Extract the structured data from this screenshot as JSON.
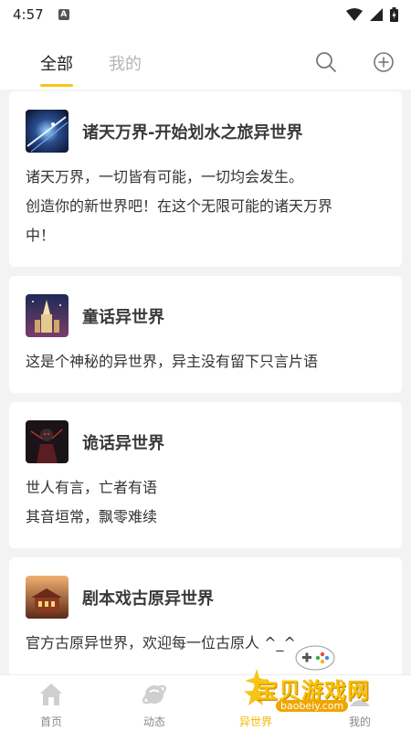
{
  "status_bar": {
    "time": "4:57",
    "notification_letter": "A"
  },
  "header": {
    "tabs": [
      {
        "label": "全部",
        "active": true
      },
      {
        "label": "我的",
        "active": false
      }
    ],
    "accent_color": "#f5c518"
  },
  "worlds": [
    {
      "title": "诸天万界-开始划水之旅异世界",
      "lines": [
        "诸天万界，一切皆有可能，一切均会发生。",
        "创造你的新世界吧！在这个无限可能的诸天万界",
        "中！"
      ],
      "avatar_icon": "galaxy-image"
    },
    {
      "title": "童话异世界",
      "lines": [
        "这是个神秘的异世界，异主没有留下只言片语"
      ],
      "avatar_icon": "castle-image"
    },
    {
      "title": "诡话异世界",
      "lines": [
        "世人有言，亡者有语",
        "其音垣常，飘零难续"
      ],
      "avatar_icon": "dark-figure-image"
    },
    {
      "title": "剧本戏古原异世界",
      "lines": [
        "官方古原异世界，欢迎每一位古原人 ^_^"
      ],
      "avatar_icon": "ancient-city-image"
    }
  ],
  "bottom_nav": {
    "items": [
      {
        "label": "首页",
        "icon": "home-icon"
      },
      {
        "label": "动态",
        "icon": "planet-icon"
      },
      {
        "label": "异世界",
        "icon": "star-icon",
        "active": true
      },
      {
        "label": "我的",
        "icon": "user-icon"
      }
    ]
  },
  "watermark": {
    "text": "宝贝游戏网",
    "url": "baobeiy.com"
  }
}
